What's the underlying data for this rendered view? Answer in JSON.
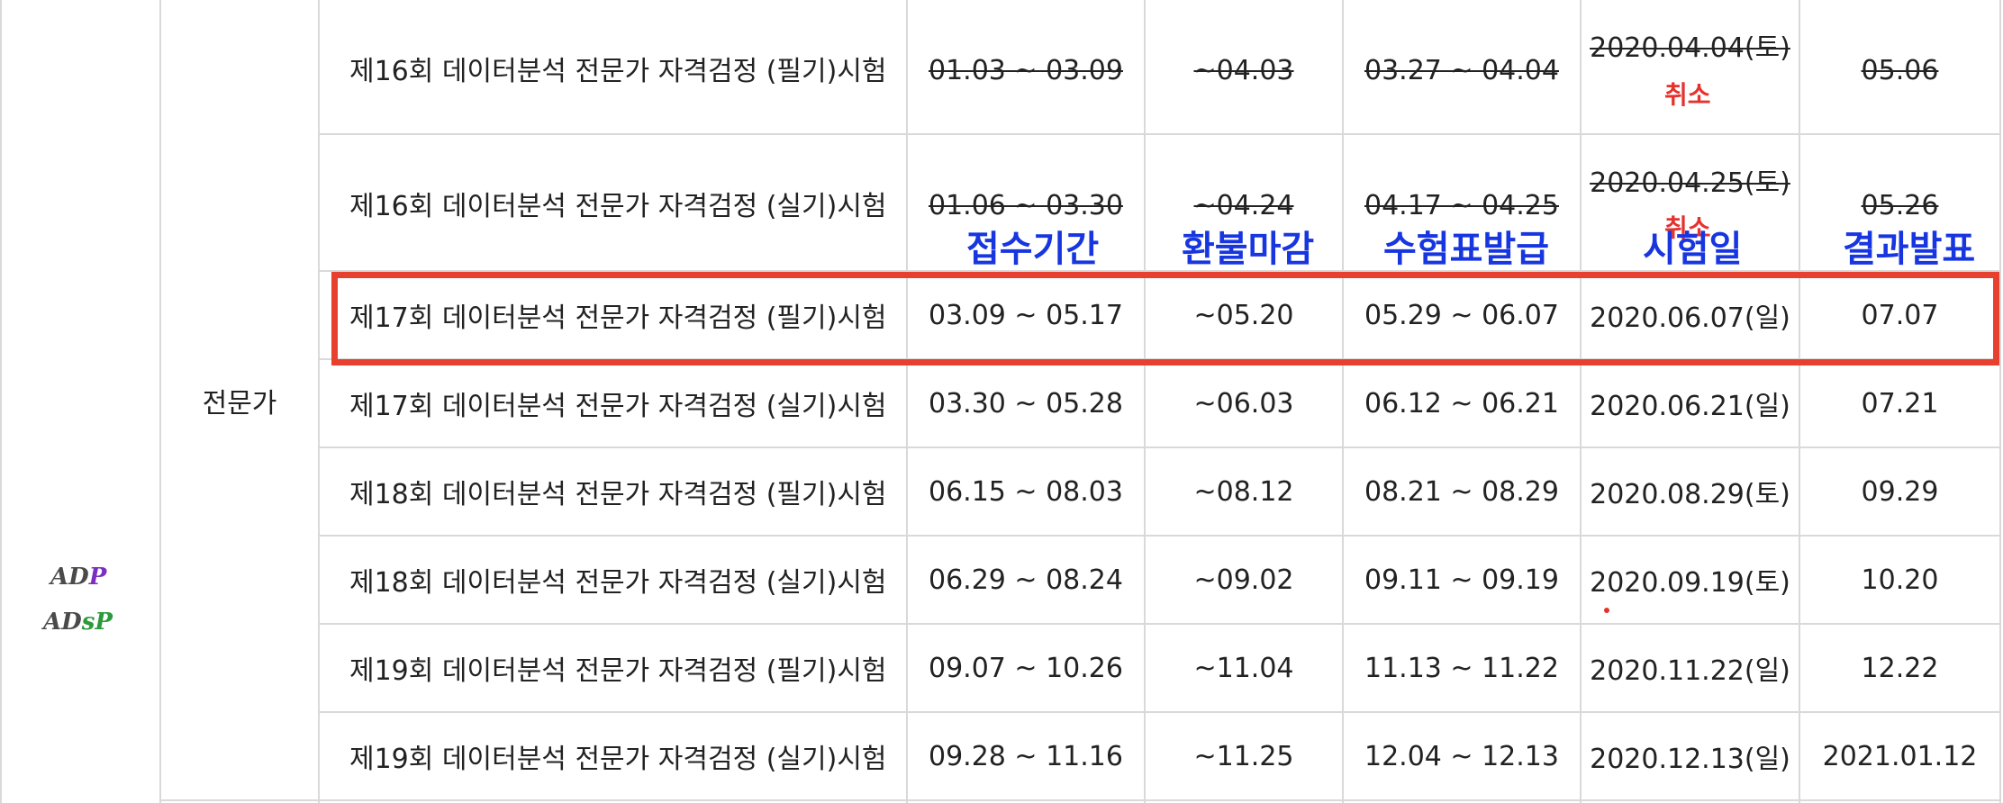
{
  "category": "전문가",
  "logos": {
    "adp": "ADP",
    "adsp": "ADsP"
  },
  "overlay_headers": [
    "접수기간",
    "환불마감",
    "수험표발급",
    "시험일",
    "결과발표"
  ],
  "rows": [
    {
      "name": "제16회 데이터분석 전문가 자격검정 (필기)시험",
      "period": "01.03 ~ 03.09",
      "refund": "~04.03",
      "ticket": "03.27 ~ 04.04",
      "exam": "2020.04.04(토)",
      "result": "05.06",
      "canceled": true,
      "cancel_label": "취소"
    },
    {
      "name": "제16회 데이터분석 전문가 자격검정 (실기)시험",
      "period": "01.06 ~ 03.30",
      "refund": "~04.24",
      "ticket": "04.17 ~ 04.25",
      "exam": "2020.04.25(토)",
      "result": "05.26",
      "canceled": true,
      "cancel_label": "취소"
    },
    {
      "name": "제17회 데이터분석 전문가 자격검정 (필기)시험",
      "period": "03.09 ~ 05.17",
      "refund": "~05.20",
      "ticket": "05.29 ~ 06.07",
      "exam": "2020.06.07(일)",
      "result": "07.07",
      "canceled": false
    },
    {
      "name": "제17회 데이터분석 전문가 자격검정 (실기)시험",
      "period": "03.30 ~ 05.28",
      "refund": "~06.03",
      "ticket": "06.12 ~ 06.21",
      "exam": "2020.06.21(일)",
      "result": "07.21",
      "canceled": false
    },
    {
      "name": "제18회 데이터분석 전문가 자격검정 (필기)시험",
      "period": "06.15 ~ 08.03",
      "refund": "~08.12",
      "ticket": "08.21 ~ 08.29",
      "exam": "2020.08.29(토)",
      "result": "09.29",
      "canceled": false
    },
    {
      "name": "제18회 데이터분석 전문가 자격검정 (실기)시험",
      "period": "06.29 ~ 08.24",
      "refund": "~09.02",
      "ticket": "09.11 ~ 09.19",
      "exam": "2020.09.19(토)",
      "result": "10.20",
      "canceled": false
    },
    {
      "name": "제19회 데이터분석 전문가 자격검정 (필기)시험",
      "period": "09.07 ~ 10.26",
      "refund": "~11.04",
      "ticket": "11.13 ~ 11.22",
      "exam": "2020.11.22(일)",
      "result": "12.22",
      "canceled": false
    },
    {
      "name": "제19회 데이터분석 전문가 자격검정 (실기)시험",
      "period": "09.28 ~ 11.16",
      "refund": "~11.25",
      "ticket": "12.04 ~ 12.13",
      "exam": "2020.12.13(일)",
      "result": "2021.01.12",
      "canceled": false
    }
  ],
  "colors": {
    "highlight": "#e8402f",
    "overlay": "#1736e0",
    "cancel": "#e5322d",
    "grid": "#d9d9d9"
  }
}
